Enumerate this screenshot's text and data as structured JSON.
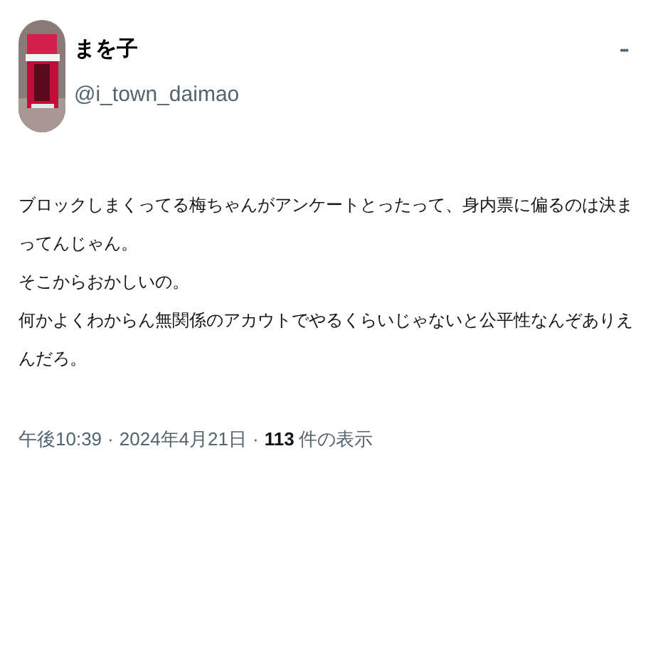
{
  "author": {
    "name": "まを子",
    "handle": "@i_town_daimao"
  },
  "more_button": "•••",
  "paragraphs": [
    "ブロックしまくってる梅ちゃんがアンケートとったって、身内票に偏るのは決まってんじゃん。",
    "そこからおかしいの。",
    "何かよくわからん無関係のアカウトでやるくらいじゃないと公平性なんぞありえんだろ。"
  ],
  "meta": [
    {
      "kind": "time",
      "text": "午後10:39"
    },
    {
      "kind": "separator",
      "text": "·"
    },
    {
      "kind": "date",
      "text": "2024年4月21日"
    },
    {
      "kind": "separator",
      "text": "·"
    },
    {
      "kind": "count",
      "text": "113"
    },
    {
      "kind": "label",
      "text": "件の表示"
    }
  ]
}
